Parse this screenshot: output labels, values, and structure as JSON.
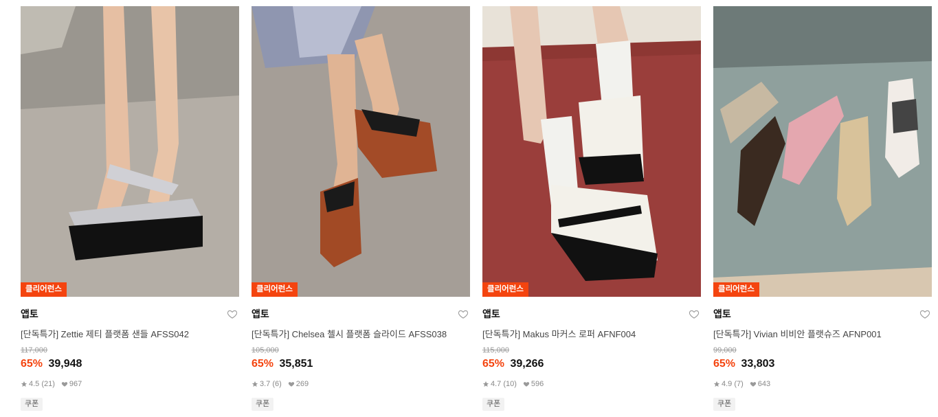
{
  "products": [
    {
      "badge": "클리어런스",
      "brand": "앱토",
      "title": "[단독특가] Zettie 제티 플랫폼 샌들 AFSS042",
      "original_price": "117,000",
      "discount": "65%",
      "price": "39,948",
      "rating": "4.5 (21)",
      "likes": "967",
      "coupon": "쿠폰"
    },
    {
      "badge": "클리어런스",
      "brand": "앱토",
      "title": "[단독특가] Chelsea 첼시 플랫폼 슬라이드 AFSS038",
      "original_price": "105,000",
      "discount": "65%",
      "price": "35,851",
      "rating": "3.7 (6)",
      "likes": "269",
      "coupon": "쿠폰"
    },
    {
      "badge": "클리어런스",
      "brand": "앱토",
      "title": "[단독특가] Makus 마커스 로퍼 AFNF004",
      "original_price": "115,000",
      "discount": "65%",
      "price": "39,266",
      "rating": "4.7 (10)",
      "likes": "596",
      "coupon": "쿠폰"
    },
    {
      "badge": "클리어런스",
      "brand": "앱토",
      "title": "[단독특가] Vivian 비비안 플랫슈즈 AFNP001",
      "original_price": "99,000",
      "discount": "65%",
      "price": "33,803",
      "rating": "4.9 (7)",
      "likes": "643",
      "coupon": "쿠폰"
    }
  ],
  "colors": {
    "accent": "#f4440f",
    "text": "#111111",
    "muted": "#888888"
  },
  "icons": {
    "wishlist": "heart-outline-icon",
    "rating": "star-icon",
    "likes": "heart-filled-icon"
  }
}
